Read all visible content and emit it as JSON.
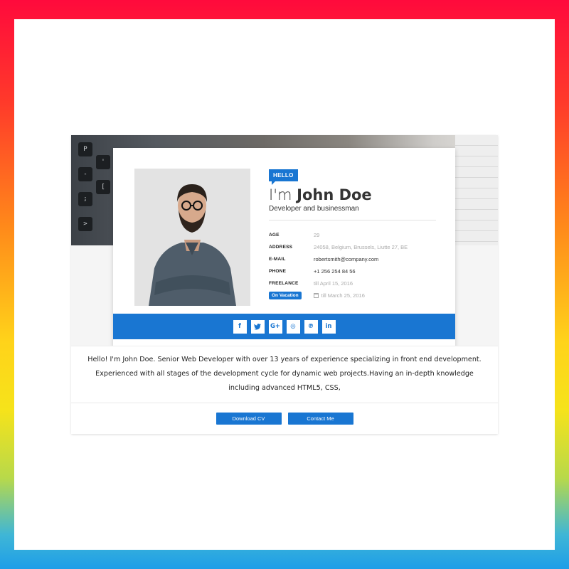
{
  "hero": {
    "keys": [
      "P",
      "-",
      ";",
      ">",
      "'",
      "["
    ]
  },
  "profile": {
    "greeting": "HELLO",
    "name_prefix": "I'm",
    "name": "John Doe",
    "role": "Developer and businessman",
    "info": [
      {
        "label": "AGE",
        "value": "29"
      },
      {
        "label": "ADDRESS",
        "value": "24058, Belgium, Brussels, Liutte 27, BE"
      },
      {
        "label": "E-MAIL",
        "value": "robertsmith@company.com"
      },
      {
        "label": "PHONE",
        "value": "+1 256 254 84 56"
      },
      {
        "label": "FREELANCE",
        "value": "till April 15, 2016"
      }
    ],
    "vacation": {
      "badge": "On Vacation",
      "value": "till March 25, 2016"
    }
  },
  "social": {
    "items": [
      {
        "name": "facebook-icon",
        "glyph": "f"
      },
      {
        "name": "twitter-icon",
        "glyph": "🐦"
      },
      {
        "name": "google-plus-icon",
        "glyph": "G+"
      },
      {
        "name": "instagram-icon",
        "glyph": "◎"
      },
      {
        "name": "pinterest-icon",
        "glyph": "℗"
      },
      {
        "name": "linkedin-icon",
        "glyph": "in"
      }
    ]
  },
  "about": {
    "text": "Hello! I'm John Doe. Senior Web Developer with over 13 years of experience specializing in front end development. Experienced with all stages of the development cycle for dynamic web projects.Having an in-depth knowledge including advanced HTML5, CSS,"
  },
  "actions": {
    "download_label": "Download CV",
    "contact_label": "Contact Me"
  },
  "colors": {
    "accent": "#1976d2"
  }
}
